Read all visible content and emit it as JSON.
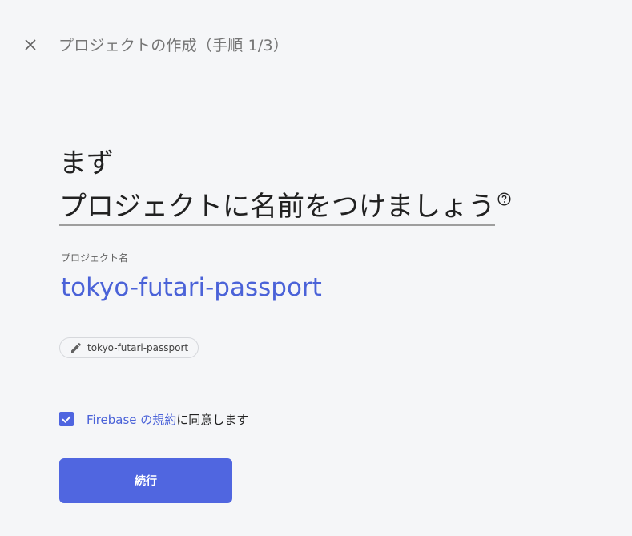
{
  "header": {
    "close_icon": "close-icon",
    "title": "プロジェクトの作成（手順 1/3）"
  },
  "heading": {
    "line1": "まず",
    "line2": "プロジェクトに名前をつけましょう",
    "help_icon": "help-circle-icon"
  },
  "project_field": {
    "label": "プロジェクト名",
    "value": "tokyo-futari-passport"
  },
  "project_id_chip": {
    "icon": "pencil-icon",
    "text": "tokyo-futari-passport"
  },
  "terms": {
    "checked": true,
    "link_text": "Firebase の規約",
    "suffix": "に同意します"
  },
  "actions": {
    "continue_label": "続行"
  },
  "colors": {
    "accent": "#5066e0",
    "link": "#4a62d8",
    "background": "#f5f6f8"
  }
}
